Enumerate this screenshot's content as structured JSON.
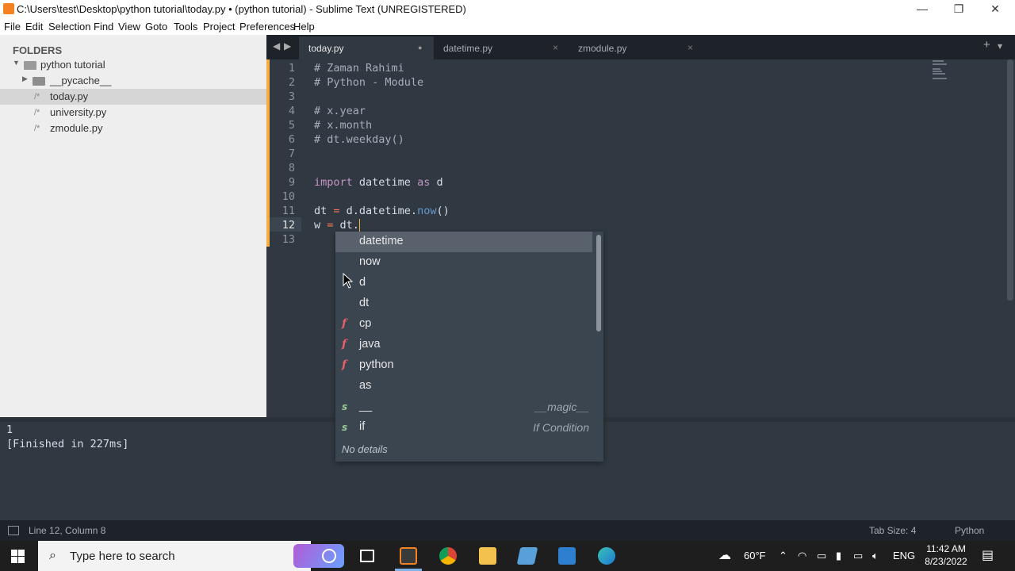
{
  "window": {
    "title": "C:\\Users\\test\\Desktop\\python tutorial\\today.py • (python tutorial) - Sublime Text (UNREGISTERED)",
    "minimize_icon": "minimize-icon",
    "restore_icon": "restore-icon",
    "close_icon": "close-icon"
  },
  "menu": [
    "File",
    "Edit",
    "Selection",
    "Find",
    "View",
    "Goto",
    "Tools",
    "Project",
    "Preferences",
    "Help"
  ],
  "sidebar": {
    "header": "FOLDERS",
    "root": "python tutorial",
    "items": [
      {
        "label": "__pycache__",
        "type": "folder"
      },
      {
        "label": "today.py",
        "type": "file",
        "prefix": "/*"
      },
      {
        "label": "university.py",
        "type": "file",
        "prefix": "/*"
      },
      {
        "label": "zmodule.py",
        "type": "file",
        "prefix": "/*"
      }
    ]
  },
  "tabs": [
    {
      "label": "today.py",
      "active": true,
      "close": "●"
    },
    {
      "label": "datetime.py",
      "active": false,
      "close": "×"
    },
    {
      "label": "zmodule.py",
      "active": false,
      "close": "×"
    }
  ],
  "tabbar": {
    "nav_left": "◀",
    "nav_right": "▶",
    "add": "+",
    "more": "▾"
  },
  "line_numbers": [
    "1",
    "2",
    "3",
    "4",
    "5",
    "6",
    "7",
    "8",
    "9",
    "10",
    "11",
    "12",
    "13"
  ],
  "code": {
    "l1": "# Zaman Rahimi",
    "l2": "# Python - Module",
    "l4": "# x.year",
    "l5": "# x.month",
    "l6": "# dt.weekday()",
    "l9_kw1": "import",
    "l9_mod": " datetime ",
    "l9_kw2": "as",
    "l9_alias": " d",
    "l11_a": "dt ",
    "l11_op": "=",
    "l11_b": " d.datetime.",
    "l11_fn": "now",
    "l11_c": "()",
    "l12_a": "w ",
    "l12_op": "=",
    "l12_b": " dt."
  },
  "autocomplete": {
    "items": [
      {
        "kind": "",
        "text": "datetime",
        "hint": ""
      },
      {
        "kind": "",
        "text": "now",
        "hint": ""
      },
      {
        "kind": "",
        "text": "d",
        "hint": ""
      },
      {
        "kind": "",
        "text": "dt",
        "hint": ""
      },
      {
        "kind": "f",
        "text": "cp",
        "hint": ""
      },
      {
        "kind": "f",
        "text": "java",
        "hint": ""
      },
      {
        "kind": "f",
        "text": "python",
        "hint": ""
      },
      {
        "kind": "",
        "text": "as",
        "hint": ""
      },
      {
        "kind": "s",
        "text": "__",
        "hint": "__magic__"
      },
      {
        "kind": "s",
        "text": "if",
        "hint": "If Condition"
      }
    ],
    "details": "No details"
  },
  "output": {
    "line1": "1",
    "line2": "[Finished in 227ms]"
  },
  "statusbar": {
    "position": "Line 12, Column 8",
    "tab_size": "Tab Size: 4",
    "syntax": "Python"
  },
  "taskbar": {
    "search_placeholder": "Type here to search",
    "weather": "60°F",
    "language": "ENG",
    "time": "11:42 AM",
    "date": "8/23/2022"
  }
}
